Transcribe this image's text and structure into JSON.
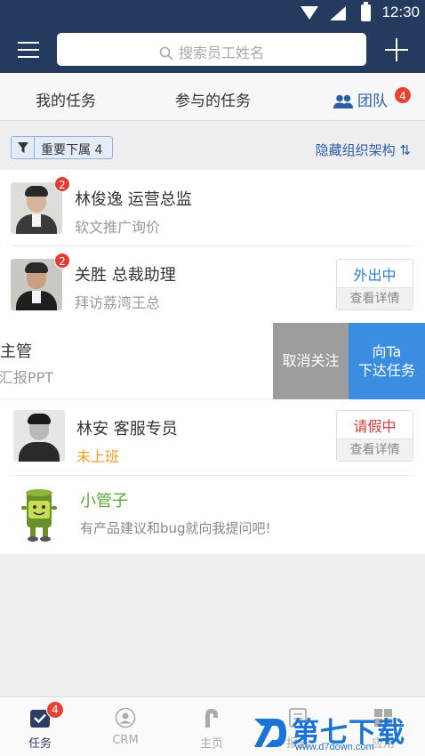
{
  "status_bar": {
    "time": "12:30"
  },
  "app_bar": {
    "search_placeholder": "搜索员工姓名"
  },
  "tabs": [
    {
      "label": "我的任务"
    },
    {
      "label": "参与的任务"
    },
    {
      "label": "团队",
      "badge": "4",
      "active": true
    }
  ],
  "filter": {
    "chip_label": "重要下属 4",
    "org_toggle": "隐藏组织架构 ⇅"
  },
  "members": [
    {
      "name": "林俊逸 运营总监",
      "task": "软文推广询价",
      "badge": "2"
    },
    {
      "name": "关胜 总裁助理",
      "task": "拜访荔湾王总",
      "badge": "2",
      "status": "外出中",
      "detail": "查看详情"
    },
    {
      "name": "主管",
      "task": "汇报PPT",
      "swipe_actions": [
        "取消关注",
        "向Ta",
        "下达任务"
      ]
    },
    {
      "name": "林安 客服专员",
      "task": "未上班",
      "status": "请假中",
      "detail": "查看详情"
    },
    {
      "name": "小管子",
      "task": "有产品建议和bug就向我提问吧!"
    }
  ],
  "bottom_nav": [
    {
      "label": "任务",
      "badge": "4",
      "icon": "task-icon"
    },
    {
      "label": "CRM",
      "icon": "crm-icon"
    },
    {
      "label": "主页",
      "icon": "home-icon"
    },
    {
      "label": "报告",
      "icon": "report-icon"
    },
    {
      "label": "应用",
      "icon": "apps-icon"
    }
  ],
  "watermark": {
    "title": "第七下载站",
    "url": "www.d7down.com"
  },
  "colors": {
    "header": "#243a5e",
    "accent": "#2c5da6",
    "badge": "#e94134",
    "assign": "#3a8de0",
    "unfollow": "#9d9d9d"
  }
}
